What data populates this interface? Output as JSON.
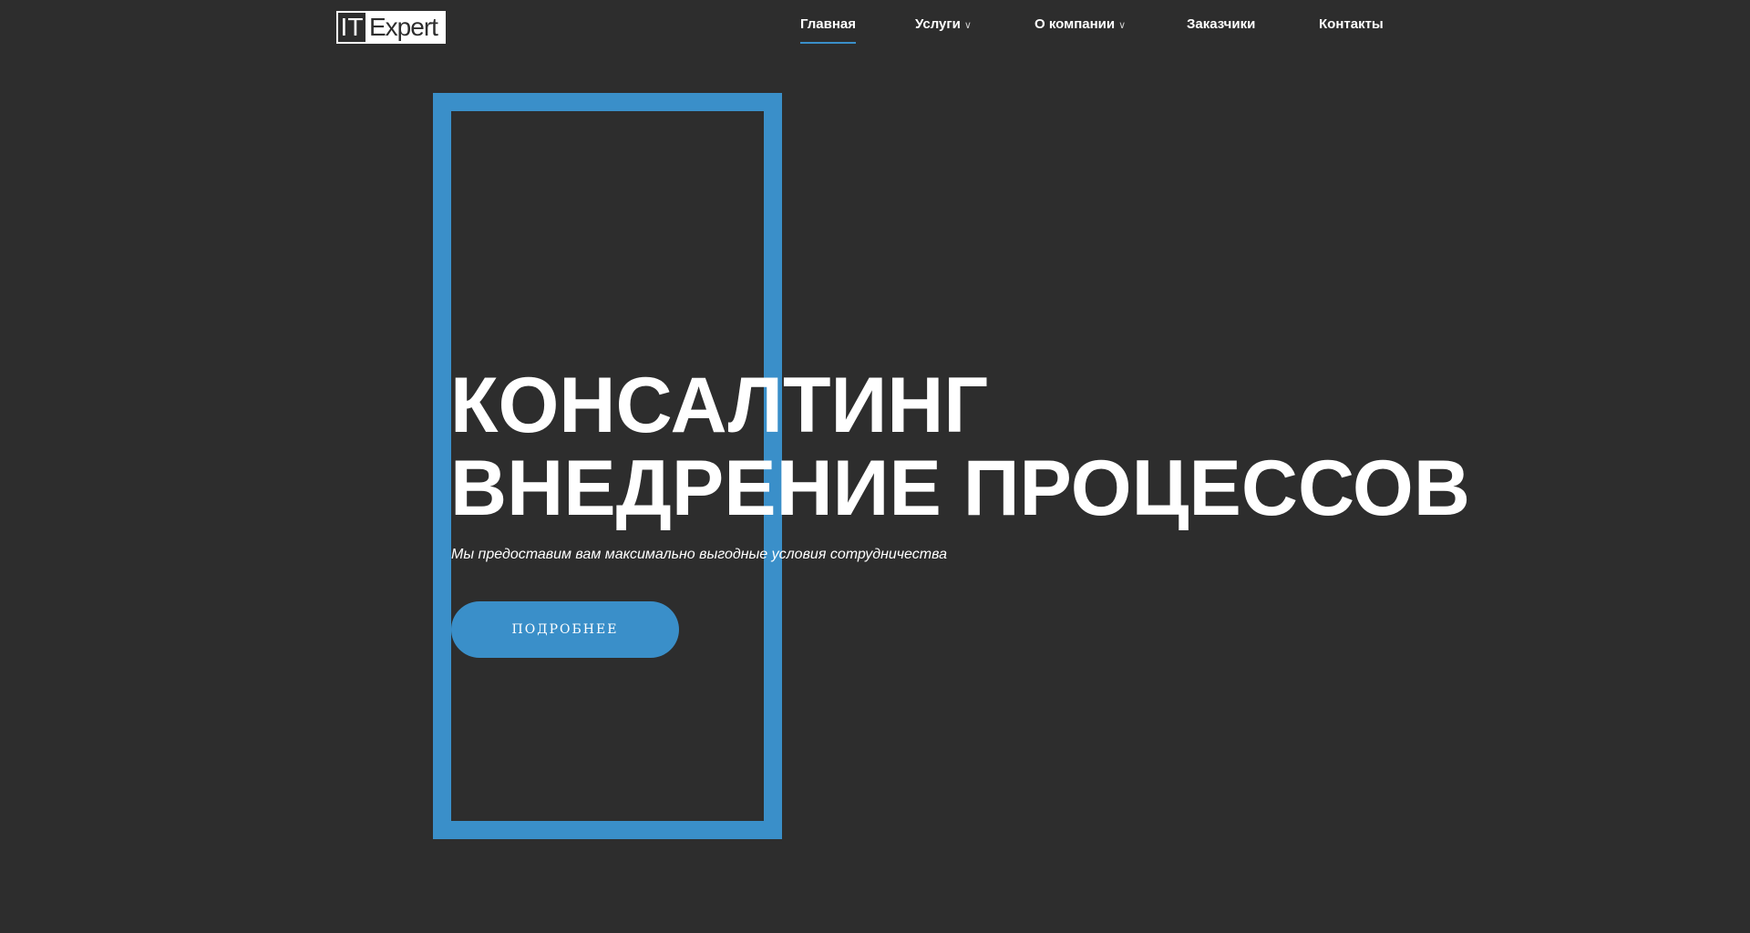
{
  "logo": {
    "part1": "IT",
    "part2": "Expert"
  },
  "nav": [
    {
      "label": "Главная",
      "active": true,
      "dropdown": false
    },
    {
      "label": "Услуги",
      "active": false,
      "dropdown": true
    },
    {
      "label": "О компании",
      "active": false,
      "dropdown": true
    },
    {
      "label": "Заказчики",
      "active": false,
      "dropdown": false
    },
    {
      "label": "Контакты",
      "active": false,
      "dropdown": false
    }
  ],
  "hero": {
    "line1": "КОНСАЛТИНГ",
    "line2": "ВНЕДРЕНИЕ ПРОЦЕССОВ",
    "subtitle": "Мы предоставим вам максимально выгодные условия сотрудничества",
    "button": "ПОДРОБНЕЕ"
  },
  "colors": {
    "background": "#2d2d2d",
    "accent": "#3a8fc9"
  }
}
